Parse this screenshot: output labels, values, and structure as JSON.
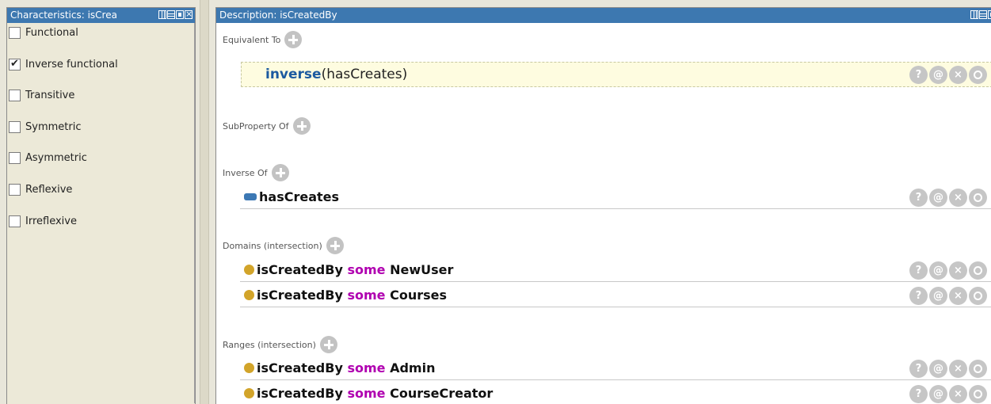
{
  "left_panel": {
    "title": "Characteristics: isCrea",
    "characteristics": [
      {
        "label": "Functional",
        "checked": false
      },
      {
        "label": "Inverse functional",
        "checked": true
      },
      {
        "label": "Transitive",
        "checked": false
      },
      {
        "label": "Symmetric",
        "checked": false
      },
      {
        "label": "Asymmetric",
        "checked": false
      },
      {
        "label": "Reflexive",
        "checked": false
      },
      {
        "label": "Irreflexive",
        "checked": false
      }
    ]
  },
  "right_panel": {
    "title": "Description: isCreatedBy",
    "sections": {
      "equivalent_to": {
        "label": "Equivalent To",
        "items": [
          {
            "keyword": "inverse",
            "text": " (hasCreates)"
          }
        ]
      },
      "subproperty_of": {
        "label": "SubProperty Of"
      },
      "inverse_of": {
        "label": "Inverse Of",
        "items": [
          {
            "text": "hasCreates"
          }
        ]
      },
      "domains": {
        "label": "Domains (intersection)",
        "items": [
          {
            "prop": "isCreatedBy",
            "kw": "some",
            "cls": "NewUser"
          },
          {
            "prop": "isCreatedBy",
            "kw": "some",
            "cls": "Courses"
          }
        ]
      },
      "ranges": {
        "label": "Ranges (intersection)",
        "items": [
          {
            "prop": "isCreatedBy",
            "kw": "some",
            "cls": "Admin"
          },
          {
            "prop": "isCreatedBy",
            "kw": "some",
            "cls": "CourseCreator"
          }
        ]
      }
    },
    "row_actions": {
      "explain": "?",
      "annotate": "@",
      "delete": "×"
    }
  },
  "colors": {
    "header_bg": "#3d78b0",
    "keyword_purple": "#b000b0",
    "keyword_blue": "#1c5aa0",
    "class_dot": "#d2a42a"
  }
}
